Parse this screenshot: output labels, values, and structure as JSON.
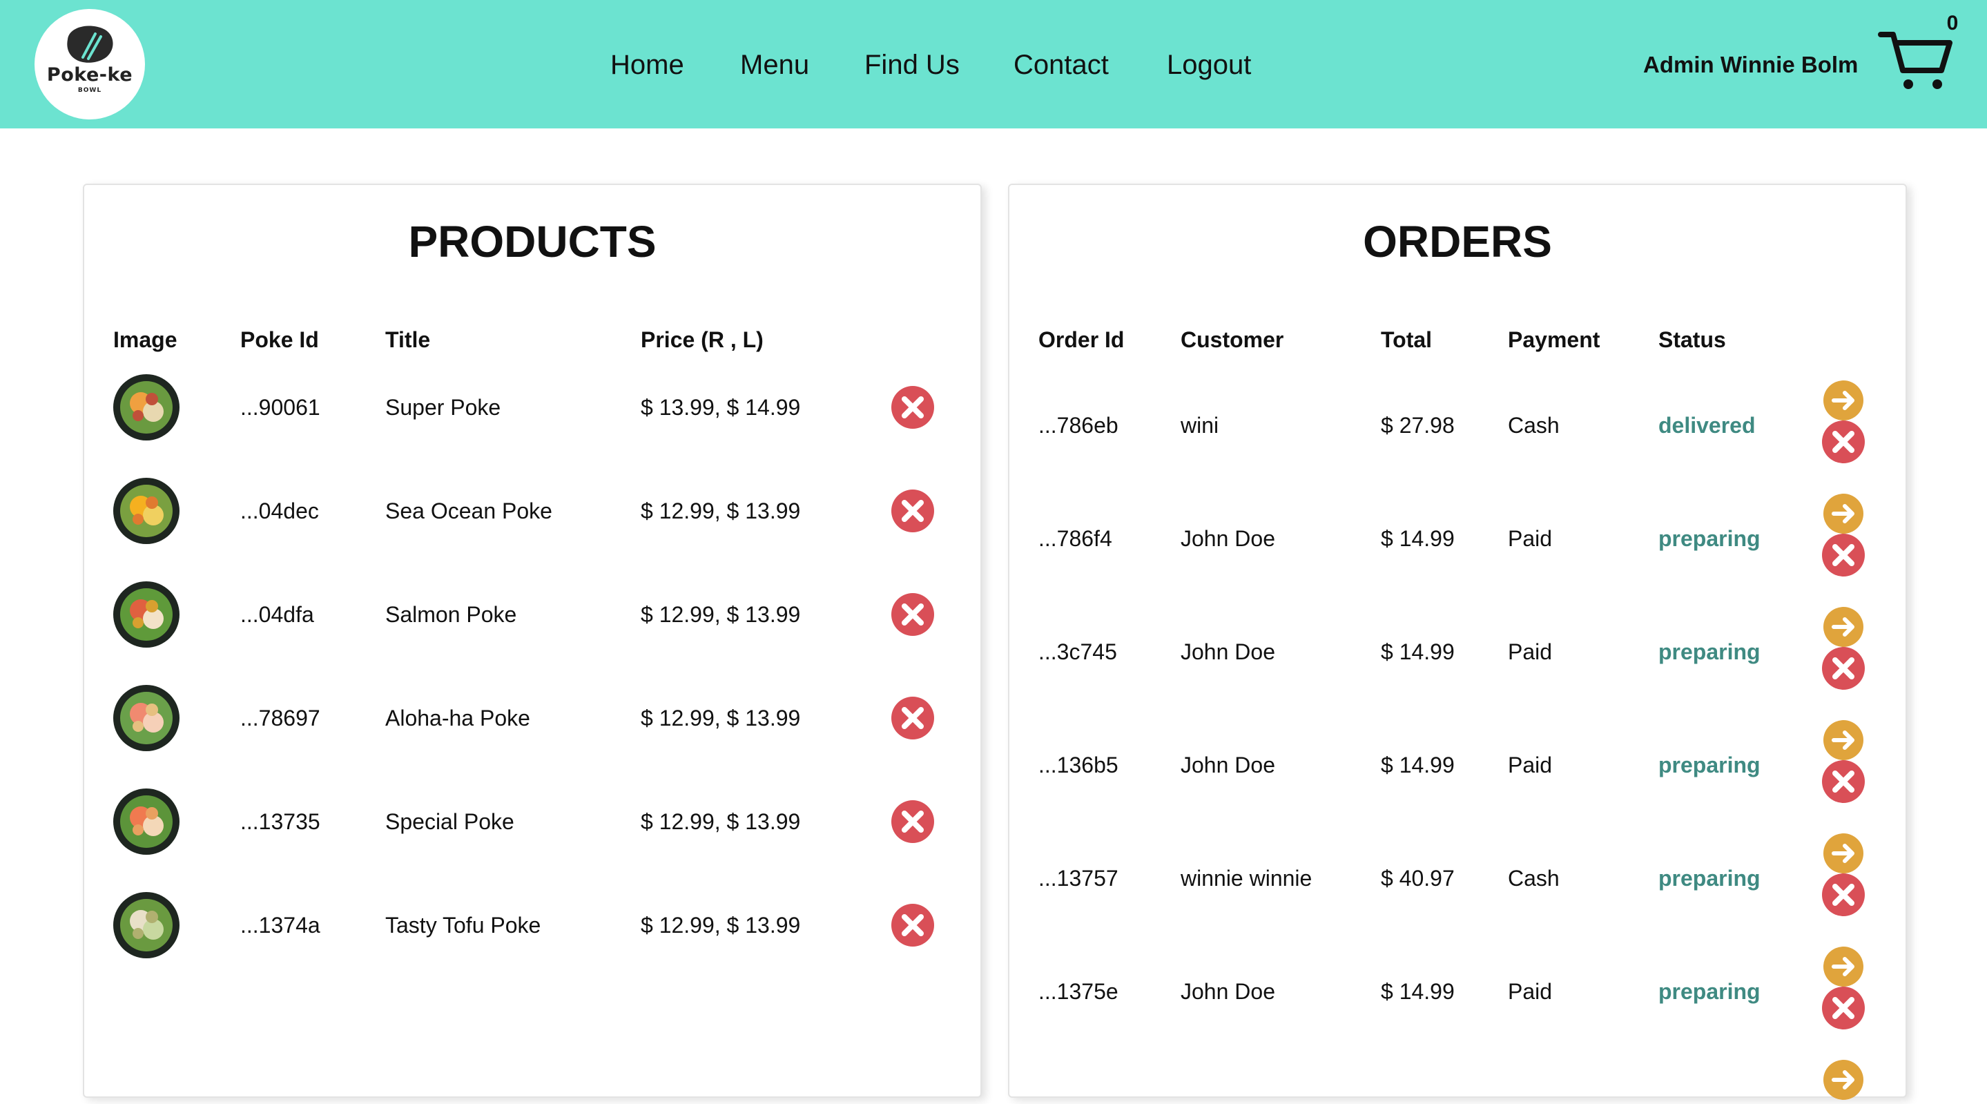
{
  "brand": {
    "logo_text": "Poke-ke",
    "logo_sub": "BOWL"
  },
  "nav": {
    "items": [
      "Home",
      "Menu",
      "Find Us",
      "Contact",
      "Logout"
    ]
  },
  "user": {
    "name": "Admin Winnie Bolm"
  },
  "cart": {
    "count": "0"
  },
  "colors": {
    "header": "#6ce3d0",
    "status": "#3f8a82",
    "delete": "#d94f57",
    "next": "#e0a43c"
  },
  "products": {
    "title": "PRODUCTS",
    "columns": [
      "Image",
      "Poke Id",
      "Title",
      "Price (R , L)"
    ],
    "rows": [
      {
        "id": "...90061",
        "title": "Super Poke",
        "price": "$ 13.99, $ 14.99"
      },
      {
        "id": "...04dec",
        "title": "Sea Ocean Poke",
        "price": "$ 12.99, $ 13.99"
      },
      {
        "id": "...04dfa",
        "title": "Salmon Poke",
        "price": "$ 12.99, $ 13.99"
      },
      {
        "id": "...78697",
        "title": "Aloha-ha Poke",
        "price": "$ 12.99, $ 13.99"
      },
      {
        "id": "...13735",
        "title": "Special Poke",
        "price": "$ 12.99, $ 13.99"
      },
      {
        "id": "...1374a",
        "title": "Tasty Tofu Poke",
        "price": "$ 12.99, $ 13.99"
      }
    ]
  },
  "orders": {
    "title": "ORDERS",
    "columns": [
      "Order Id",
      "Customer",
      "Total",
      "Payment",
      "Status"
    ],
    "rows": [
      {
        "id": "...786eb",
        "customer": "wini",
        "total": "$ 27.98",
        "payment": "Cash",
        "status": "delivered"
      },
      {
        "id": "...786f4",
        "customer": "John Doe",
        "total": "$ 14.99",
        "payment": "Paid",
        "status": "preparing"
      },
      {
        "id": "...3c745",
        "customer": "John Doe",
        "total": "$ 14.99",
        "payment": "Paid",
        "status": "preparing"
      },
      {
        "id": "...136b5",
        "customer": "John Doe",
        "total": "$ 14.99",
        "payment": "Paid",
        "status": "preparing"
      },
      {
        "id": "...13757",
        "customer": "winnie winnie",
        "total": "$ 40.97",
        "payment": "Cash",
        "status": "preparing"
      },
      {
        "id": "...1375e",
        "customer": "John Doe",
        "total": "$ 14.99",
        "payment": "Paid",
        "status": "preparing"
      }
    ]
  }
}
